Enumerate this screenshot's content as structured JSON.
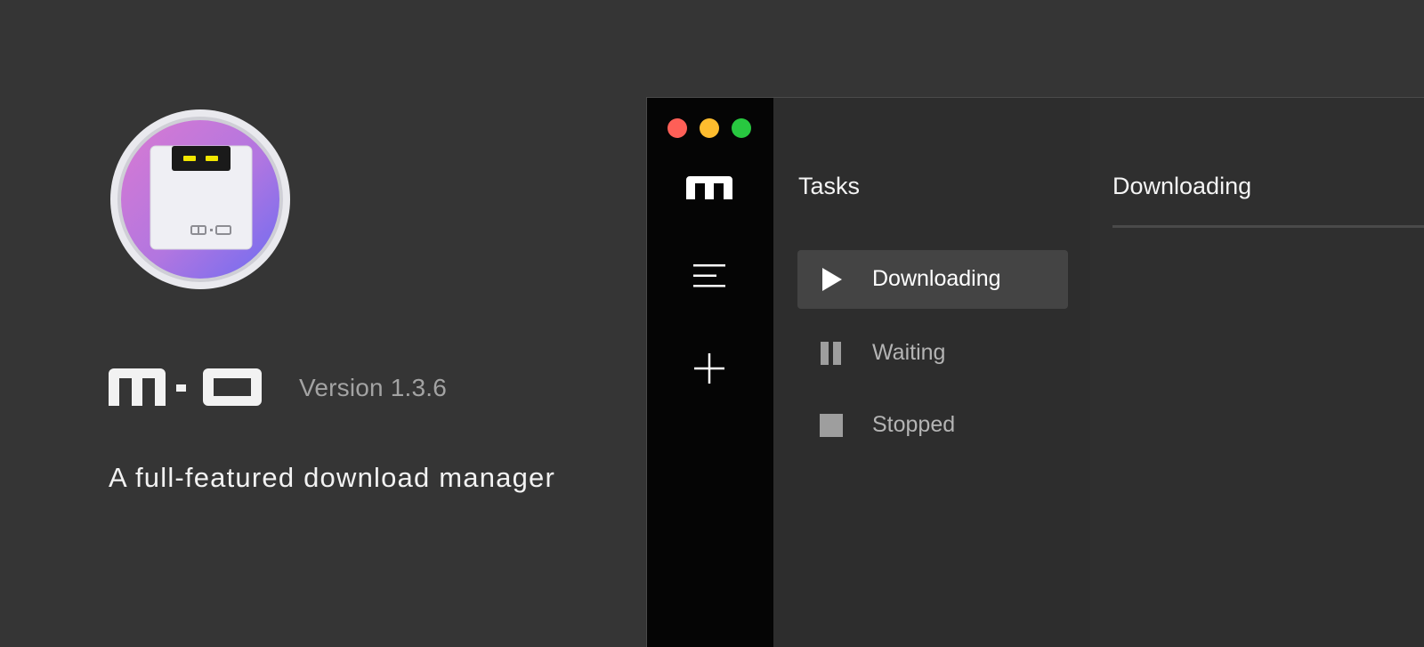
{
  "promo": {
    "app_name_logo": "m·o",
    "version": "Version 1.3.6",
    "tagline": "A full-featured download manager",
    "icon_badge_text": "m·o"
  },
  "window": {
    "traffic_lights": [
      "close",
      "minimize",
      "maximize"
    ],
    "rail": {
      "logo": "m",
      "items": [
        {
          "name": "menu-icon"
        },
        {
          "name": "plus-icon"
        }
      ]
    },
    "tasks": {
      "title": "Tasks",
      "items": [
        {
          "label": "Downloading",
          "icon": "play-icon",
          "active": true
        },
        {
          "label": "Waiting",
          "icon": "pause-icon",
          "active": false
        },
        {
          "label": "Stopped",
          "icon": "stop-icon",
          "active": false
        }
      ]
    },
    "content": {
      "title": "Downloading"
    }
  },
  "colors": {
    "background": "#353535",
    "rail": "#050505",
    "active_item": "#444444",
    "icon_gradient_start": "#d47ad6",
    "icon_gradient_end": "#6f6cf0",
    "led": "#f2e600"
  }
}
